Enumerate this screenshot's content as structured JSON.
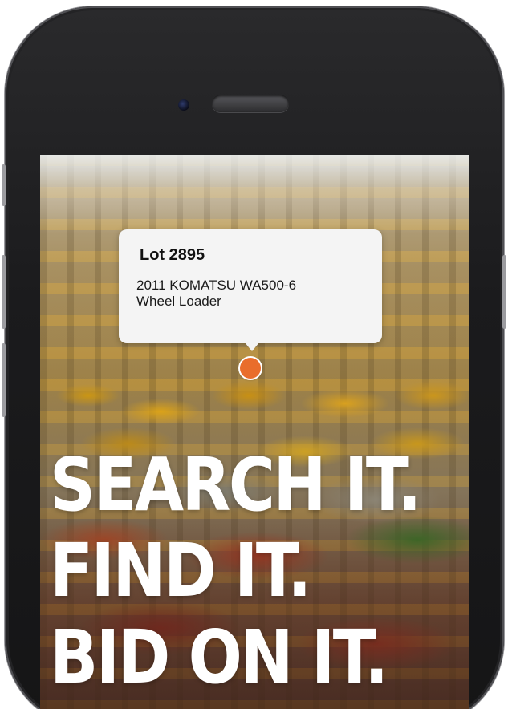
{
  "listing_callout": {
    "lot_title": "Lot 2895",
    "description_line1": "2011 KOMATSU WA500-6",
    "description_line2": "Wheel Loader"
  },
  "headline": {
    "line1": "SEARCH IT.",
    "line2": "FIND IT.",
    "line3": "BID ON IT."
  },
  "colors": {
    "pin": "#e96d2b",
    "headline_text": "#ffffff",
    "callout_bg": "#f4f4f4"
  },
  "icons": {
    "location_pin": "map-pin-icon"
  }
}
